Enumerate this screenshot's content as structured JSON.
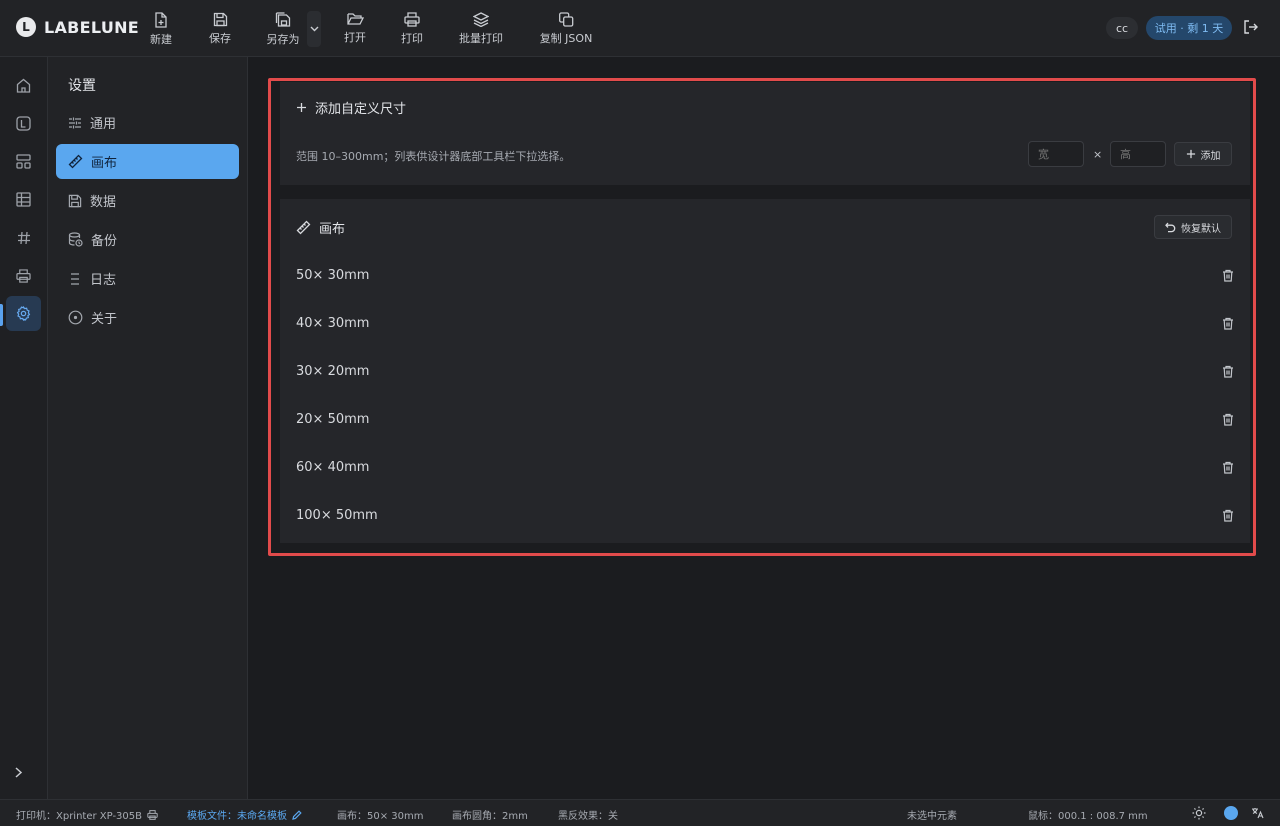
{
  "app": {
    "logo_letter": "L",
    "name": "LABELUNE"
  },
  "toolbar": {
    "new_label": "新建",
    "save_label": "保存",
    "save_as_label": "另存为",
    "open_label": "打开",
    "print_label": "打印",
    "batch_print_label": "批量打印",
    "copy_json_label": "复制 JSON"
  },
  "user": {
    "initials": "cc",
    "trial_badge": "试用 · 剩 1 天"
  },
  "sidebar": {
    "title": "设置",
    "items": [
      {
        "label": "通用",
        "icon": "sliders-icon"
      },
      {
        "label": "画布",
        "icon": "ruler-icon",
        "active": true
      },
      {
        "label": "数据",
        "icon": "database-save-icon"
      },
      {
        "label": "备份",
        "icon": "backup-icon"
      },
      {
        "label": "日志",
        "icon": "list-icon"
      },
      {
        "label": "关于",
        "icon": "info-circle-icon"
      }
    ]
  },
  "custom_size": {
    "title": "添加自定义尺寸",
    "hint": "范围 10–300mm；列表供设计器底部工具栏下拉选择。",
    "width_placeholder": "宽",
    "height_placeholder": "高",
    "times": "×",
    "add_label": "添加"
  },
  "canvas_list": {
    "title": "画布",
    "reset_label": "恢复默认",
    "sizes": [
      "50× 30mm",
      "40× 30mm",
      "30× 20mm",
      "20× 50mm",
      "60× 40mm",
      "100× 50mm"
    ]
  },
  "status": {
    "printer": "打印机：Xprinter XP-305B",
    "template_label": "模板文件：",
    "template_name": "未命名模板",
    "canvas": "画布：50× 30mm",
    "corner": "画布圆角：2mm",
    "invert": "黑反效果：关",
    "selection": "未选中元素",
    "cursor": "鼠标：000.1 : 008.7 mm"
  },
  "colors": {
    "accent": "#5aa7ef",
    "highlight_border": "#e24b4b",
    "background": "#1b1c1f",
    "panel": "#25262a"
  }
}
